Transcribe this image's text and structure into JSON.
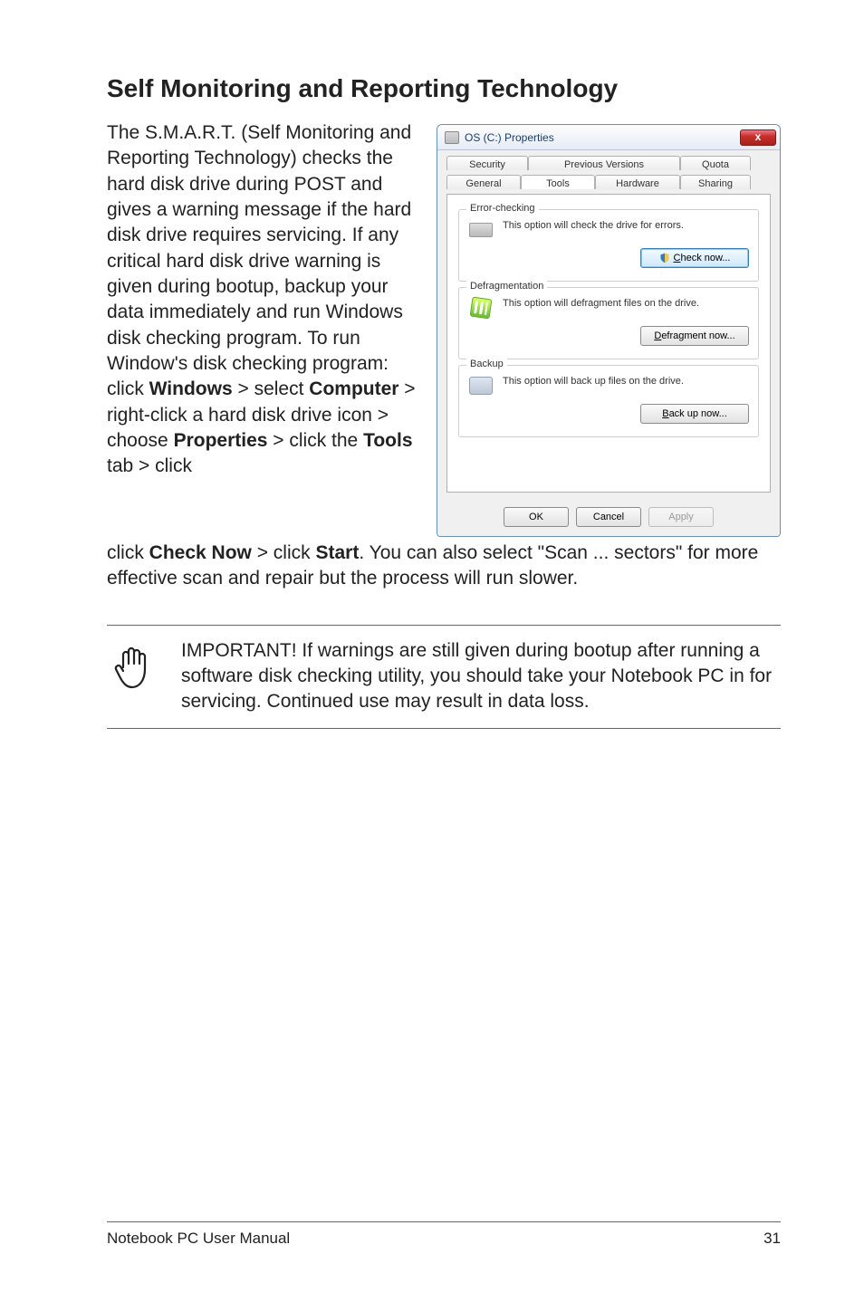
{
  "heading": "Self Monitoring and Reporting Technology",
  "paragraph_parts": {
    "p1": "The S.M.A.R.T. (Self Monitoring and Reporting Technology) checks the hard disk drive during POST and gives a warning message if the hard disk drive requires servicing. If any critical hard disk drive warning is given during bootup, backup your data immediately and run Windows disk checking program. To run Window's disk checking program: click ",
    "b1": "Windows",
    "gt1": " > select ",
    "b2": "Computer",
    "p2": " > right-click a hard disk drive icon > choose ",
    "b3": "Properties",
    "p3": " > click the ",
    "b4": "Tools",
    "p4": " tab > click ",
    "b5": "Check Now",
    "p5": " > click ",
    "b6": "Start",
    "p6": ". You can also select \"Scan ... sectors\" for more effective scan and repair but the process will run slower."
  },
  "note": "IMPORTANT! If warnings are still given during bootup after running a software disk checking utility, you should take your Notebook PC in for servicing. Continued use may result in data loss.",
  "footer_left": "Notebook PC User Manual",
  "footer_right": "31",
  "dialog": {
    "title": "OS (C:) Properties",
    "close": "x",
    "tabs_row1": {
      "security": "Security",
      "previous": "Previous Versions",
      "quota": "Quota"
    },
    "tabs_row2": {
      "general": "General",
      "tools": "Tools",
      "hardware": "Hardware",
      "sharing": "Sharing"
    },
    "groups": {
      "error": {
        "label": "Error-checking",
        "text": "This option will check the drive for errors.",
        "button": "Check now...",
        "button_underline": "C"
      },
      "defrag": {
        "label": "Defragmentation",
        "text": "This option will defragment files on the drive.",
        "button": "Defragment now...",
        "button_underline": "D"
      },
      "backup": {
        "label": "Backup",
        "text": "This option will back up files on the drive.",
        "button": "Back up now...",
        "button_underline": "B"
      }
    },
    "footer": {
      "ok": "OK",
      "cancel": "Cancel",
      "apply": "Apply"
    }
  }
}
